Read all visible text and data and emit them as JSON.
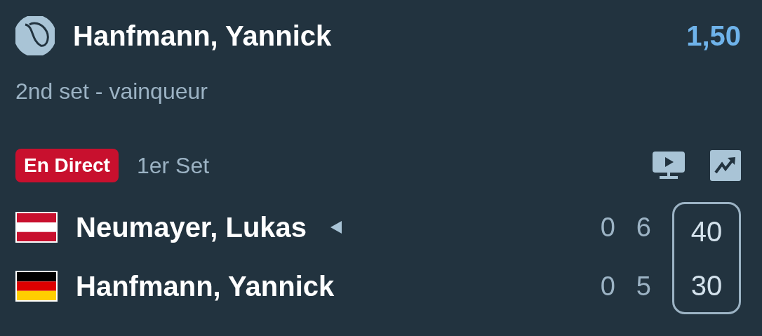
{
  "selection": {
    "name": "Hanfmann, Yannick",
    "odds": "1,50",
    "market": "2nd set - vainqueur"
  },
  "status": {
    "badge": "En Direct",
    "period": "1er Set"
  },
  "players": [
    {
      "name": "Neumayer, Lukas",
      "kind": "austria",
      "serving": true,
      "sets": [
        "0",
        "6"
      ],
      "points": "40"
    },
    {
      "name": "Hanfmann, Yannick",
      "kind": "germany",
      "serving": false,
      "sets": [
        "0",
        "5"
      ],
      "points": "30"
    }
  ]
}
